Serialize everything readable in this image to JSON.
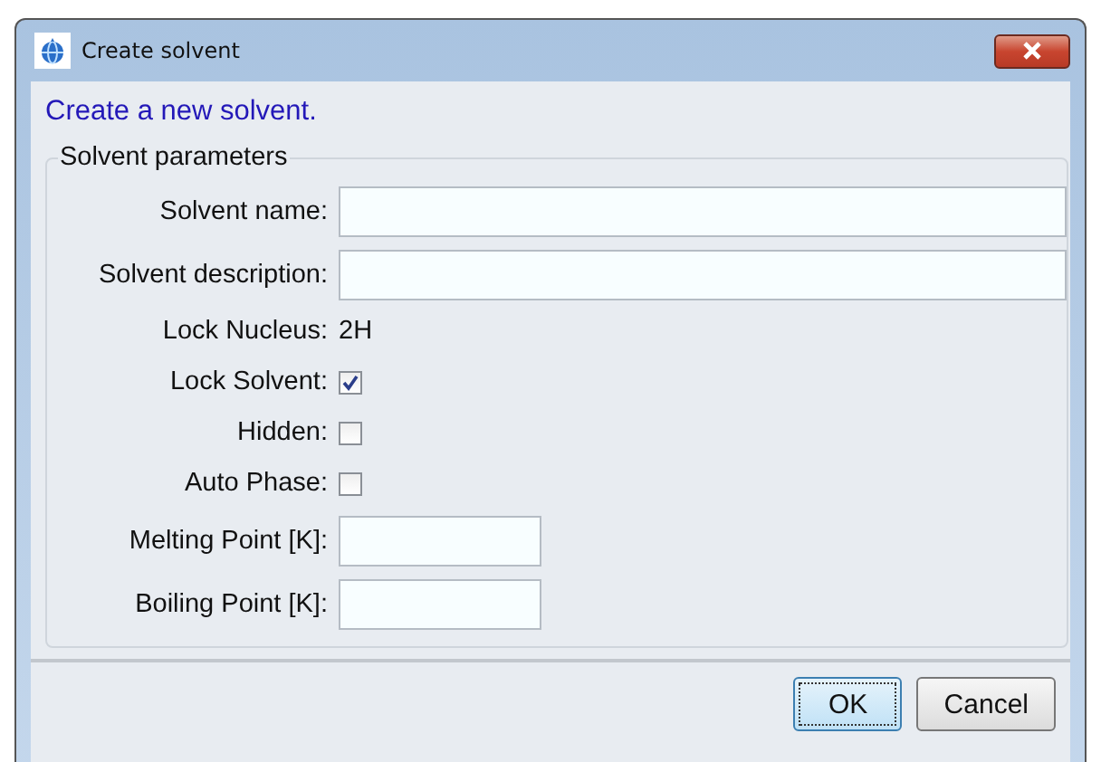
{
  "window": {
    "title": "Create solvent"
  },
  "heading": "Create a new solvent.",
  "group": {
    "title": "Solvent parameters",
    "rows": [
      {
        "kind": "field",
        "label": "Solvent name:"
      },
      {
        "kind": "field",
        "label": "Solvent description:"
      },
      {
        "kind": "value",
        "label": "Lock Nucleus:",
        "value": "2H"
      },
      {
        "kind": "checkbox",
        "label": "Lock Solvent:",
        "checked": true
      },
      {
        "kind": "checkbox",
        "label": "Hidden:",
        "checked": false
      },
      {
        "kind": "checkbox",
        "label": "Auto Phase:",
        "checked": false
      },
      {
        "kind": "short-field",
        "label": "Melting Point [K]:"
      },
      {
        "kind": "short-field",
        "label": "Boiling Point [K]:"
      }
    ]
  },
  "buttons": [
    {
      "label": "OK",
      "focused": true
    },
    {
      "label": "Cancel",
      "focused": false
    }
  ]
}
